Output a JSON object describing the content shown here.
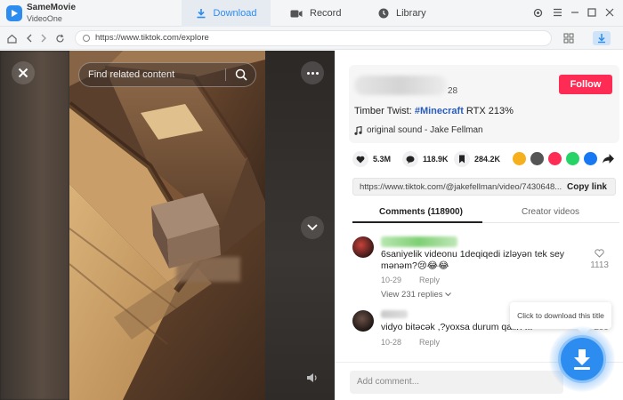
{
  "app": {
    "name": "SameMovie",
    "subtitle": "VideoOne",
    "accent": "#2d8cf0"
  },
  "tabs": [
    {
      "label": "Download",
      "icon": "download-icon",
      "active": true
    },
    {
      "label": "Record",
      "icon": "record-icon",
      "active": false
    },
    {
      "label": "Library",
      "icon": "library-icon",
      "active": false
    }
  ],
  "address": {
    "url": "https://www.tiktok.com/explore"
  },
  "video": {
    "search_placeholder": "Find related content"
  },
  "post": {
    "handle_suffix": "28",
    "follow_label": "Follow",
    "desc_prefix": "Timber Twist: ",
    "hashtag": "#Minecraft",
    "desc_suffix": " RTX 213%",
    "sound": "original sound - Jake Fellman",
    "likes": "5.3M",
    "comments": "118.9K",
    "saves": "284.2K",
    "link": "https://www.tiktok.com/@jakefellman/video/7430648...",
    "copy_label": "Copy link",
    "accent_follow": "#fe2c55"
  },
  "comment_tabs": {
    "comments": "Comments (118900)",
    "creator": "Creator videos"
  },
  "comments": [
    {
      "text": "6saniyelik videonu 1deqiqedi izləyən tek sey mənəm?😢😂😂",
      "date": "10-29",
      "reply": "Reply",
      "likes": "1113",
      "view_replies": "View 231 replies"
    },
    {
      "text": "vidyo bitəcək ,?yoxsa durum qalırı ...",
      "date": "10-28",
      "reply": "Reply",
      "likes": "299"
    }
  ],
  "add_comment_placeholder": "Add comment...",
  "download_tooltip": "Click to download this title"
}
